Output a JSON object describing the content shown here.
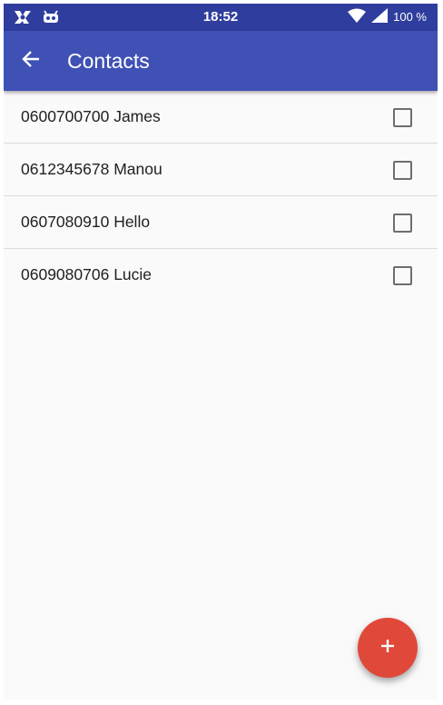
{
  "status_bar": {
    "time": "18:52",
    "battery": "100 %",
    "left_icons": [
      "notification-app-icon",
      "android-robot-icon"
    ],
    "right_icons": [
      "wifi-icon",
      "cell-signal-icon"
    ]
  },
  "toolbar": {
    "title": "Contacts",
    "back_icon": "arrow-back-icon"
  },
  "contacts": [
    {
      "label": "0600700700 James",
      "checked": false
    },
    {
      "label": "0612345678 Manou",
      "checked": false
    },
    {
      "label": "0607080910 Hello",
      "checked": false
    },
    {
      "label": "0609080706 Lucie",
      "checked": false
    }
  ],
  "fab": {
    "icon": "plus-icon"
  },
  "colors": {
    "status_bar": "#2f3e9e",
    "app_bar": "#3f51b5",
    "background": "#fafafa",
    "fab": "#e0493a",
    "divider": "#dcdcdc",
    "text": "#212121"
  }
}
